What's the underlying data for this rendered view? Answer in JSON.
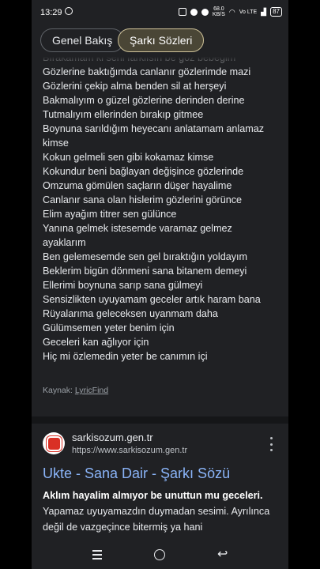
{
  "status_bar": {
    "time": "13:29",
    "speed_top": "68.0",
    "speed_bottom": "KB/S",
    "network": "Vo LTE",
    "battery": "87"
  },
  "tabs": [
    {
      "label": "Genel Bakış",
      "active": false
    },
    {
      "label": "Şarkı Sözleri",
      "active": true
    }
  ],
  "lyrics": {
    "lines": [
      "Bırakamam ki seni farklısın be göz bebeğim",
      "Gözlerine baktığımda canlanır gözlerimde mazi",
      "Gözlerini çekip alma benden sil at herşeyi",
      "Bakmalıyım o güzel gözlerine derinden derine",
      "Tutmalıyım ellerinden bırakıp gitmee",
      "Boynuna sarıldığım heyecanı anlatamam anlamaz",
      "kimse",
      "Kokun gelmeli sen gibi kokamaz kimse",
      "Kokundur beni bağlayan değişince gözlerinde",
      "Omzuma gömülen saçların düşer hayalime",
      "Canlanır sana olan hislerim gözlerini görünce",
      "Elim ayağım titrer sen gülünce",
      "Yanına gelmek istesemde varamaz gelmez",
      "ayaklarım",
      "Ben gelemesemde sen gel bıraktığın yoldayım",
      "Beklerim bigün dönmeni sana bitanem demeyi",
      "Ellerimi boynuna sarıp sana gülmeyi",
      "Sensizlikten uyuyamam geceler artık haram bana",
      "Rüyalarıma geleceksen uyanmam daha",
      "Gülümsemen yeter benim için",
      "Geceleri kan ağlıyor için",
      "Hiç mi özlemedin yeter be canımın içi"
    ],
    "source_label": "Kaynak:",
    "source_link": "LyricFind"
  },
  "result": {
    "site_name": "sarkisozum.gen.tr",
    "url": "https://www.sarkisozum.gen.tr",
    "title": "Ukte - Sana Dair - Şarkı Sözü",
    "snippet_bold": "Aklım hayalim almıyor be unuttun mu geceleri.",
    "snippet_rest": " Yapamaz uyuyamazdın duymadan sesimi. Ayrılınca değil de vazgeçince bitermiş ya hani"
  },
  "colors": {
    "background": "#202124",
    "link": "#8ab4f8",
    "active_tab_border": "#cfc39a"
  }
}
